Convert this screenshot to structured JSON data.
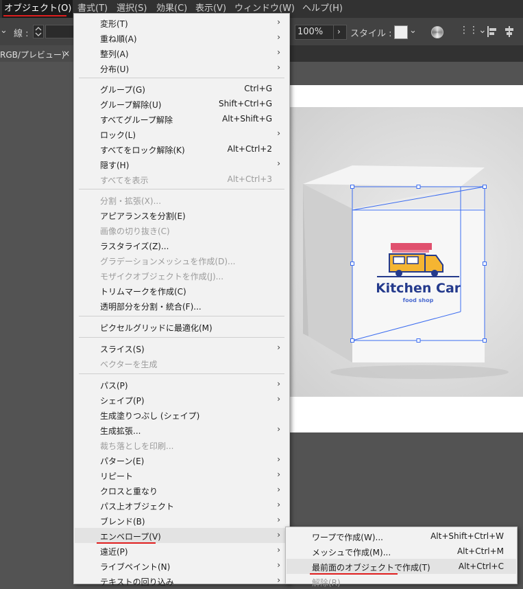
{
  "menubar": {
    "items": [
      "オブジェクト(O)",
      "書式(T)",
      "選択(S)",
      "効果(C)",
      "表示(V)",
      "ウィンドウ(W)",
      "ヘルプ(H)"
    ]
  },
  "controlbar": {
    "stroke_label": "線 :",
    "zoom": "100%",
    "style_label": "スタイル :"
  },
  "tab": {
    "label": "RGB/プレビュー)",
    "close": "×"
  },
  "object_menu": {
    "items": [
      {
        "label": "変形(T)",
        "submenu": true
      },
      {
        "label": "重ね順(A)",
        "submenu": true
      },
      {
        "label": "整列(A)",
        "submenu": true
      },
      {
        "label": "分布(U)",
        "submenu": true
      },
      {
        "label": "グループ(G)",
        "shortcut": "Ctrl+G"
      },
      {
        "label": "グループ解除(U)",
        "shortcut": "Shift+Ctrl+G"
      },
      {
        "label": "すべてグループ解除",
        "shortcut": "Alt+Shift+G"
      },
      {
        "label": "ロック(L)",
        "submenu": true
      },
      {
        "label": "すべてをロック解除(K)",
        "shortcut": "Alt+Ctrl+2"
      },
      {
        "label": "隠す(H)",
        "submenu": true
      },
      {
        "label": "すべてを表示",
        "shortcut": "Alt+Ctrl+3",
        "disabled": true
      },
      {
        "label": "分割・拡張(X)...",
        "disabled": true
      },
      {
        "label": "アピアランスを分割(E)"
      },
      {
        "label": "画像の切り抜き(C)",
        "disabled": true
      },
      {
        "label": "ラスタライズ(Z)..."
      },
      {
        "label": "グラデーションメッシュを作成(D)...",
        "disabled": true
      },
      {
        "label": "モザイクオブジェクトを作成(J)...",
        "disabled": true
      },
      {
        "label": "トリムマークを作成(C)"
      },
      {
        "label": "透明部分を分割・統合(F)..."
      },
      {
        "label": "ピクセルグリッドに最適化(M)"
      },
      {
        "label": "スライス(S)",
        "submenu": true
      },
      {
        "label": "ベクターを生成",
        "disabled": true
      },
      {
        "label": "パス(P)",
        "submenu": true
      },
      {
        "label": "シェイプ(P)",
        "submenu": true
      },
      {
        "label": "生成塗りつぶし (シェイプ)"
      },
      {
        "label": "生成拡張...",
        "submenu": true
      },
      {
        "label": "裁ち落としを印刷...",
        "disabled": true
      },
      {
        "label": "パターン(E)",
        "submenu": true
      },
      {
        "label": "リピート",
        "submenu": true
      },
      {
        "label": "クロスと重なり",
        "submenu": true
      },
      {
        "label": "パス上オブジェクト",
        "submenu": true
      },
      {
        "label": "ブレンド(B)",
        "submenu": true
      },
      {
        "label": "エンベロープ(V)",
        "submenu": true,
        "highlighted": true
      },
      {
        "label": "遠近(P)",
        "submenu": true
      },
      {
        "label": "ライブペイント(N)",
        "submenu": true
      },
      {
        "label": "テキストの回り込み",
        "submenu": true
      }
    ]
  },
  "envelope_submenu": {
    "items": [
      {
        "label": "ワープで作成(W)...",
        "shortcut": "Alt+Shift+Ctrl+W"
      },
      {
        "label": "メッシュで作成(M)...",
        "shortcut": "Alt+Ctrl+M"
      },
      {
        "label": "最前面のオブジェクトで作成(T)",
        "shortcut": "Alt+Ctrl+C",
        "highlighted": true
      },
      {
        "label": "解除(R)",
        "disabled": true
      }
    ]
  },
  "artwork": {
    "logo_title": "Kitchen Car",
    "logo_subtitle": "food shop"
  },
  "colors": {
    "accent_red": "#e01e1e",
    "selection_blue": "#3b6cf0",
    "logo_navy": "#243a8c",
    "truck_yellow": "#f5b532",
    "awning_pink": "#e0506e"
  }
}
